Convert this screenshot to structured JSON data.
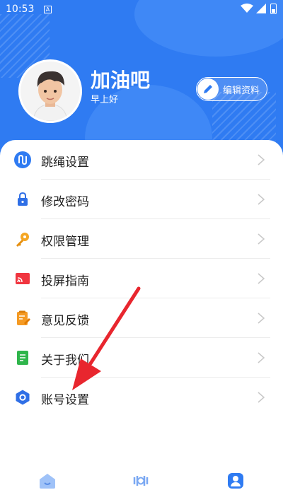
{
  "status_bar": {
    "time": "10:53",
    "notification_letter": "A"
  },
  "profile": {
    "username": "加油吧",
    "greeting": "早上好",
    "edit_label": "编辑资料"
  },
  "menu": [
    {
      "label": "跳绳设置",
      "icon": "jump-rope-icon",
      "color": "#2f7bf2"
    },
    {
      "label": "修改密码",
      "icon": "lock-icon",
      "color": "#2f6fe6"
    },
    {
      "label": "权限管理",
      "icon": "key-icon",
      "color": "#f5a623"
    },
    {
      "label": "投屏指南",
      "icon": "cast-icon",
      "color": "#f0353f"
    },
    {
      "label": "意见反馈",
      "icon": "feedback-icon",
      "color": "#f59a23"
    },
    {
      "label": "关于我们",
      "icon": "about-icon",
      "color": "#2fb54b"
    },
    {
      "label": "账号设置",
      "icon": "account-settings-icon",
      "color": "#2f6fe6"
    }
  ],
  "tabs": [
    {
      "icon": "home-icon",
      "active": false
    },
    {
      "icon": "jump-rope-tab-icon",
      "active": false
    },
    {
      "icon": "profile-icon",
      "active": true
    }
  ],
  "colors": {
    "primary": "#2f7bf2",
    "annotation_arrow": "#e8262e"
  }
}
